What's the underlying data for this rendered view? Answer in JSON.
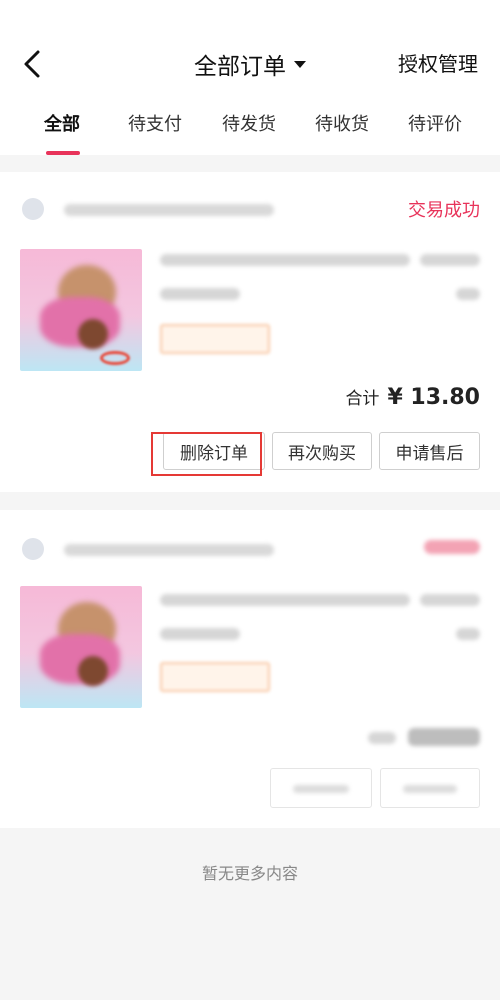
{
  "header": {
    "back_icon": "chevron-left-icon",
    "title": "全部订单",
    "dropdown_icon": "caret-down-icon",
    "auth_label": "授权管理"
  },
  "tabs": [
    {
      "label": "全部",
      "active": true
    },
    {
      "label": "待支付",
      "active": false
    },
    {
      "label": "待发货",
      "active": false
    },
    {
      "label": "待收货",
      "active": false
    },
    {
      "label": "待评价",
      "active": false
    }
  ],
  "orders": [
    {
      "status": "交易成功",
      "total_label": "合计",
      "total_amount": "¥ 13.80",
      "actions": [
        "删除订单",
        "再次购买",
        "申请售后"
      ]
    }
  ],
  "footer": {
    "note": "暂无更多内容"
  },
  "colors": {
    "accent": "#e8335a",
    "highlight": "#e53935"
  }
}
